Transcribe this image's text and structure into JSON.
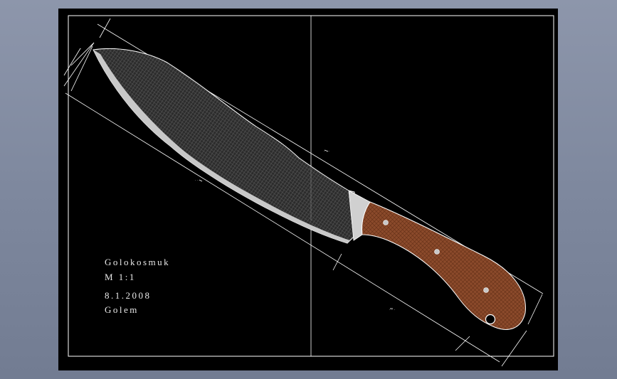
{
  "drawing": {
    "title_block": {
      "name": "Golokosmuk",
      "scale": "M  1:1",
      "date": "8.1.2008",
      "author": "Golem"
    }
  },
  "colors": {
    "background": "#7e889e",
    "sheet": "#000000",
    "lines": "#ffffff",
    "blade_edge": "#c8c8c8",
    "handle": "#8b4a2b"
  }
}
